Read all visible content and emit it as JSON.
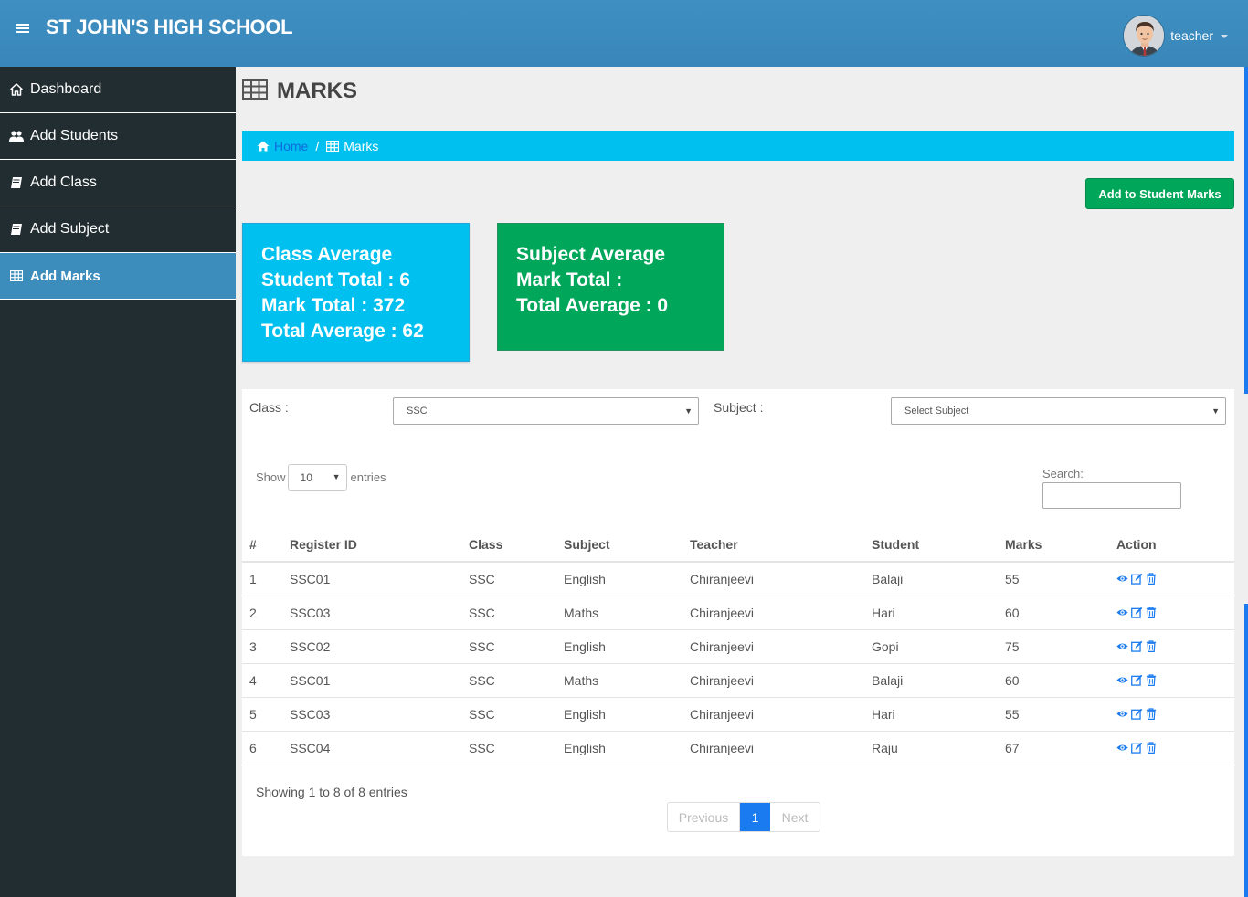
{
  "header": {
    "title": "ST JOHN'S HIGH SCHOOL",
    "user": "teacher"
  },
  "sidebar": {
    "items": [
      {
        "label": "Dashboard",
        "icon": "home-icon"
      },
      {
        "label": "Add Students",
        "icon": "users-icon"
      },
      {
        "label": "Add Class",
        "icon": "book-icon"
      },
      {
        "label": "Add Subject",
        "icon": "book-icon"
      },
      {
        "label": "Add Marks",
        "icon": "table-icon",
        "active": true
      }
    ]
  },
  "page": {
    "title": "MARKS"
  },
  "breadcrumb": {
    "home": "Home",
    "separator": "/",
    "current": "Marks"
  },
  "actions": {
    "add_button": "Add to Student Marks"
  },
  "class_stats": {
    "title": "Class Average",
    "student_total": "Student Total : 6",
    "mark_total": "Mark Total : 372",
    "total_average": "Total Average : 62"
  },
  "subject_stats": {
    "title": "Subject Average",
    "mark_total": "Mark Total :",
    "total_average": "Total Average : 0"
  },
  "filters": {
    "class_label": "Class :",
    "class_value": "SSC",
    "subject_label": "Subject :",
    "subject_value": "Select Subject"
  },
  "table_controls": {
    "show": "Show",
    "length": "10",
    "entries": "entries",
    "search_label": "Search:"
  },
  "table": {
    "columns": [
      "#",
      "Register ID",
      "Class",
      "Subject",
      "Teacher",
      "Student",
      "Marks",
      "Action"
    ],
    "rows": [
      [
        "1",
        "SSC01",
        "SSC",
        "English",
        "Chiranjeevi",
        "Balaji",
        "55"
      ],
      [
        "2",
        "SSC03",
        "SSC",
        "Maths",
        "Chiranjeevi",
        "Hari",
        "60"
      ],
      [
        "3",
        "SSC02",
        "SSC",
        "English",
        "Chiranjeevi",
        "Gopi",
        "75"
      ],
      [
        "4",
        "SSC01",
        "SSC",
        "Maths",
        "Chiranjeevi",
        "Balaji",
        "60"
      ],
      [
        "5",
        "SSC03",
        "SSC",
        "English",
        "Chiranjeevi",
        "Hari",
        "55"
      ],
      [
        "6",
        "SSC04",
        "SSC",
        "English",
        "Chiranjeevi",
        "Raju",
        "67"
      ]
    ]
  },
  "footer": {
    "info": "Showing 1 to 8 of 8 entries",
    "previous": "Previous",
    "page": "1",
    "next": "Next"
  },
  "colors": {
    "header": "#3c8dbc",
    "sidebar": "#222d32",
    "aqua": "#00c0ef",
    "green": "#00a65a",
    "link": "#1a7bf0"
  }
}
